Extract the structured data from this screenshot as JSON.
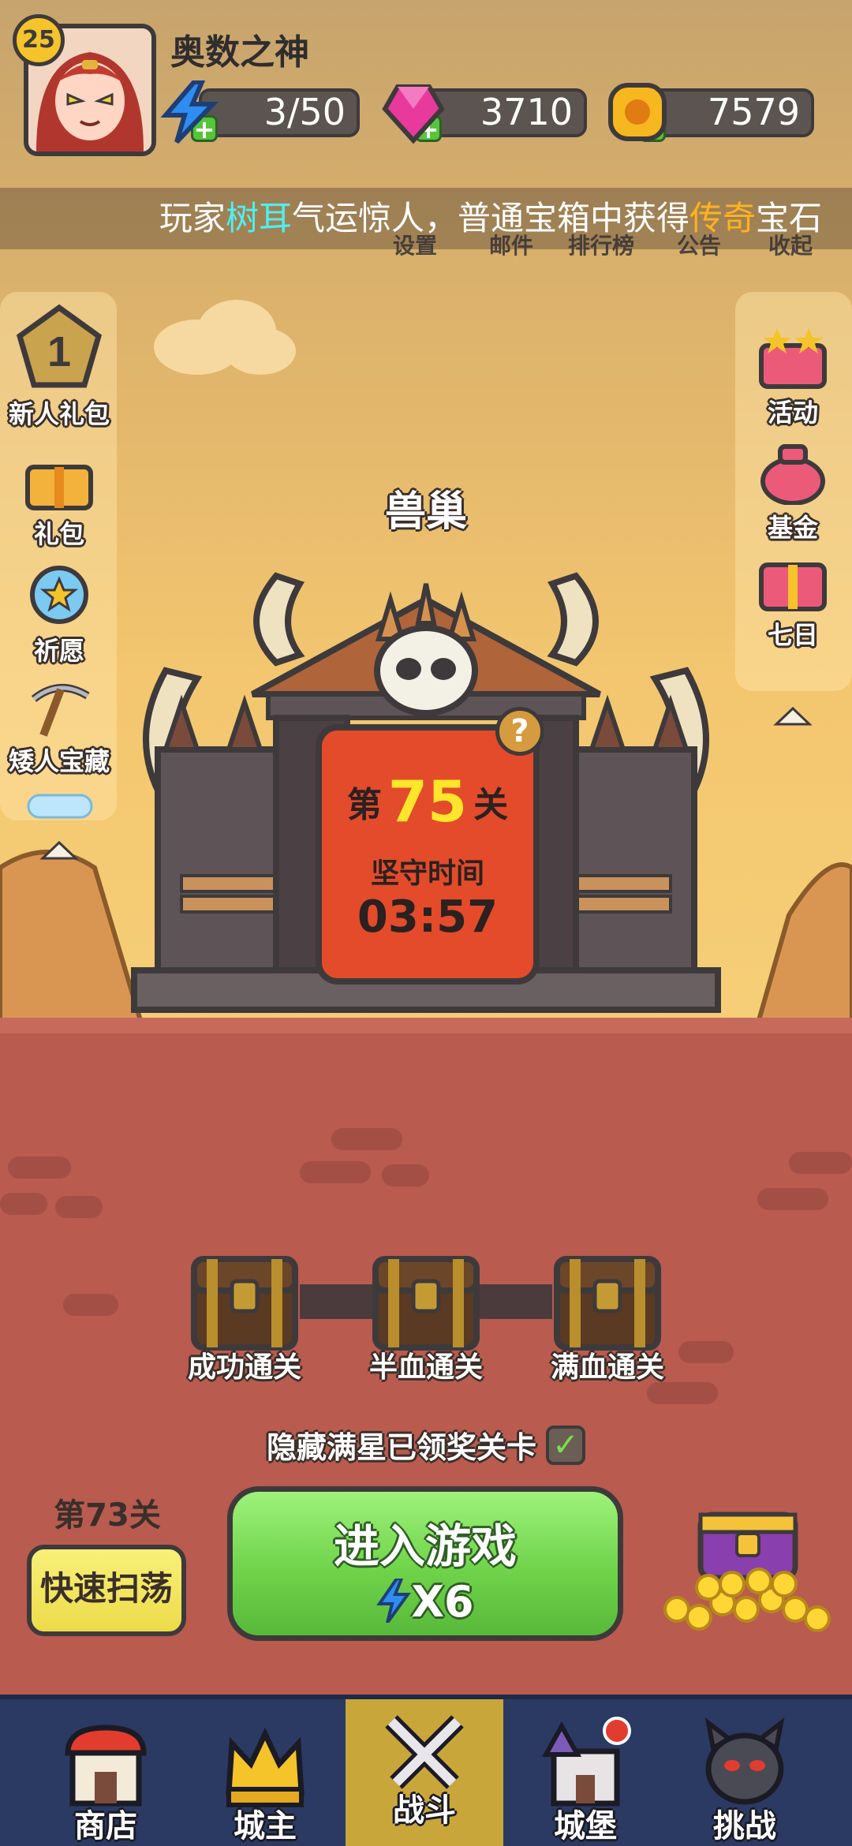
{
  "player": {
    "level": "25",
    "name": "奥数之神"
  },
  "resources": {
    "energy": {
      "icon": "lightning-icon",
      "value": "3/50"
    },
    "gems": {
      "icon": "pink-gem-icon",
      "value": "3710"
    },
    "coins": {
      "icon": "gold-coin-icon",
      "value": "7579"
    }
  },
  "ticker": {
    "pre": "玩家",
    "player": "树耳",
    "mid": "气运惊人，普通宝箱中获得",
    "item": "传奇",
    "post": "宝石"
  },
  "top_menu": [
    "设置",
    "邮件",
    "排行榜",
    "公告",
    "收起"
  ],
  "left_menu": [
    {
      "label": "新人礼包",
      "icon": "star-badge-icon",
      "badge": "1"
    },
    {
      "label": "礼包",
      "icon": "gift-box-icon"
    },
    {
      "label": "祈愿",
      "icon": "wish-orb-icon"
    },
    {
      "label": "矮人宝藏",
      "icon": "pickaxe-icon"
    }
  ],
  "right_menu": [
    {
      "label": "活动",
      "icon": "event-gift-icon"
    },
    {
      "label": "基金",
      "icon": "money-bag-icon"
    },
    {
      "label": "七日",
      "icon": "seven-day-gift-icon"
    }
  ],
  "stage": {
    "name": "兽巢",
    "prefix": "第",
    "number": "75",
    "suffix": "关",
    "hold_label": "坚守时间",
    "hold_time": "03:57",
    "help": "?"
  },
  "chests": [
    {
      "label": "成功通关"
    },
    {
      "label": "半血通关"
    },
    {
      "label": "满血通关"
    }
  ],
  "hide_stars": {
    "label": "隐藏满星已领奖关卡",
    "checked": true
  },
  "sweep": {
    "stage": "第73关",
    "button": "快速扫荡"
  },
  "enter": {
    "label": "进入游戏",
    "cost": "X6"
  },
  "nav": [
    {
      "label": "商店",
      "icon": "shop-icon"
    },
    {
      "label": "城主",
      "icon": "crown-icon"
    },
    {
      "label": "战斗",
      "icon": "crossed-swords-icon",
      "active": true
    },
    {
      "label": "城堡",
      "icon": "castle-icon"
    },
    {
      "label": "挑战",
      "icon": "demon-icon"
    }
  ],
  "colors": {
    "accent_green": "#6fd34a",
    "stage_red": "#e34b2a",
    "nav_bg": "#2b3a63",
    "nav_active": "#c9a63a"
  }
}
